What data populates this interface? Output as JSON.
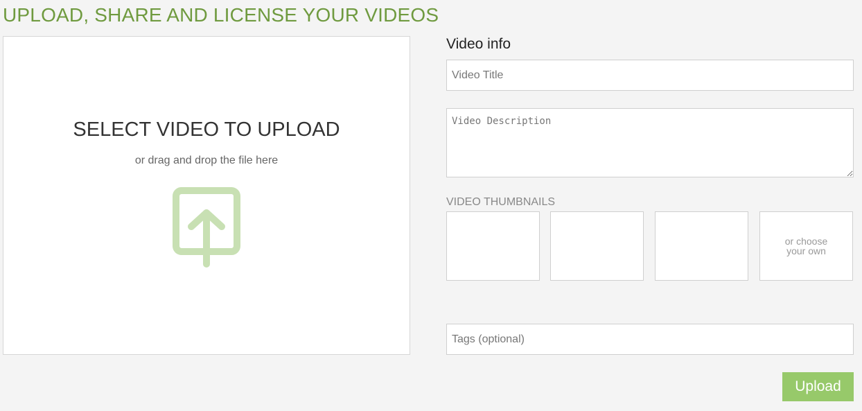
{
  "page": {
    "title": "UPLOAD, SHARE AND LICENSE YOUR VIDEOS"
  },
  "dropzone": {
    "heading": "SELECT VIDEO TO UPLOAD",
    "subtext": "or drag and drop the file here",
    "icon": "upload-arrow-icon",
    "icon_color": "#c8e0b3"
  },
  "video_info": {
    "heading": "Video info",
    "title_placeholder": "Video Title",
    "title_value": "",
    "description_placeholder": "Video Description",
    "description_value": "",
    "thumbnails_label": "VIDEO THUMBNAILS",
    "choose_own_label": "or choose your own",
    "tags_placeholder": "Tags (optional)",
    "tags_value": ""
  },
  "actions": {
    "upload_label": "Upload"
  },
  "colors": {
    "accent": "#6f9a3f",
    "button": "#97c96a",
    "background": "#f4f4f4"
  }
}
